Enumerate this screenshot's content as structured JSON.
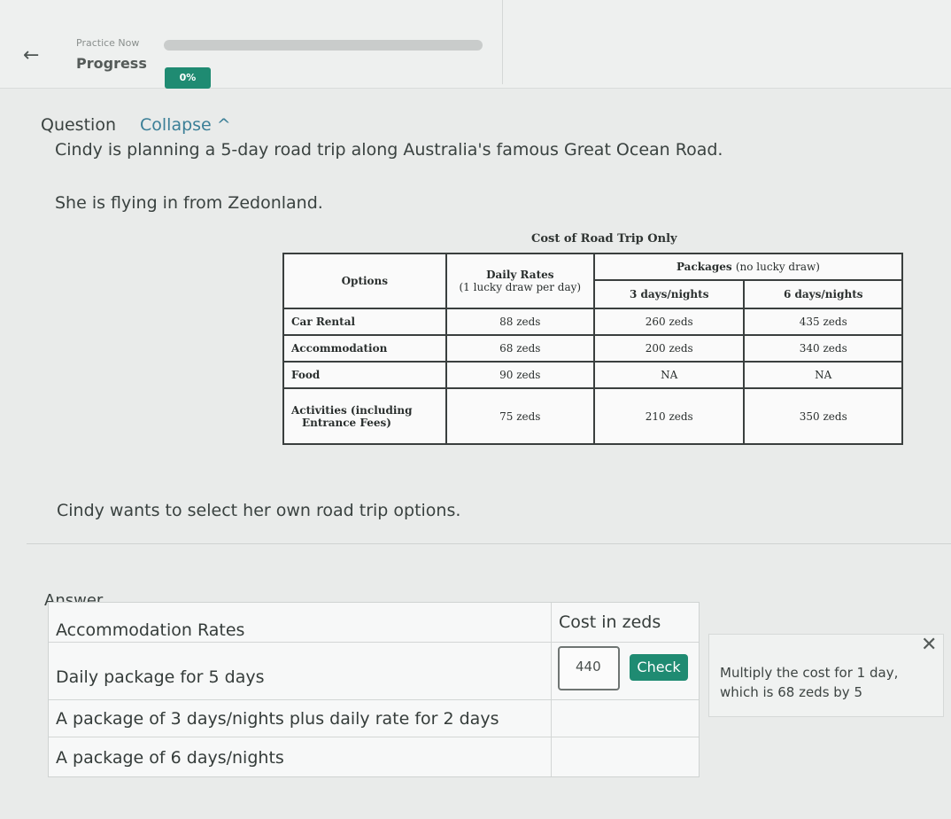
{
  "header": {
    "back_icon": "left-arrow-icon",
    "small_title": "Practice Now",
    "progress_label": "Progress",
    "progress_value": "0%",
    "progress_fraction": 0.0,
    "accent_color": "#1f8b72"
  },
  "question": {
    "heading": "Question",
    "collapse_label": "Collapse ^",
    "line1": "Cindy is planning a  5-day road trip along Australia's famous Great Ocean Road.",
    "line2": "She is flying in from Zedonland.",
    "line3": "Cindy wants to select her own road trip options."
  },
  "cost_table": {
    "caption": "Cost of Road Trip Only",
    "head_options": "Options",
    "head_daily": "Daily Rates",
    "head_daily_sub": "(1 lucky draw per day)",
    "head_packages": "Packages",
    "head_packages_note": "(no lucky draw)",
    "head_3days": "3 days/nights",
    "head_6days": "6 days/nights",
    "rows": [
      {
        "option": "Car Rental",
        "daily": "88 zeds",
        "p3": "260 zeds",
        "p6": "435 zeds"
      },
      {
        "option": "Accommodation",
        "daily": "68 zeds",
        "p3": "200 zeds",
        "p6": "340 zeds"
      },
      {
        "option": "Food",
        "daily": "90 zeds",
        "p3": "NA",
        "p6": "NA"
      },
      {
        "option": "Activities (including",
        "option_line2": "Entrance Fees)",
        "daily": "75 zeds",
        "p3": "210 zeds",
        "p6": "350 zeds"
      }
    ]
  },
  "answer": {
    "label": "Answer",
    "col1_header": "Accommodation Rates",
    "col2_header": "Cost in zeds",
    "rows": [
      "Daily package for 5 days",
      "A package of 3 days/nights plus daily rate for 2 days",
      "A package of 6 days/nights"
    ],
    "input_value": "440",
    "check_label": "Check",
    "feedback_text": "Multiply the cost for 1 day, which is 68 zeds by 5",
    "close_icon": "close-icon"
  }
}
